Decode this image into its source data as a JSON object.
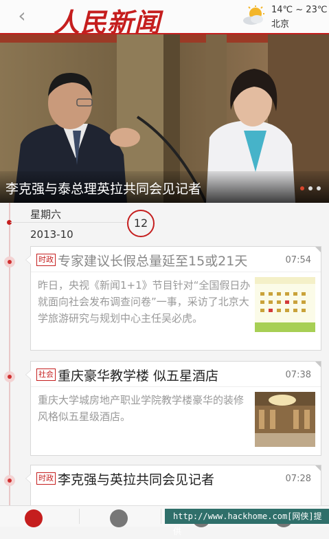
{
  "header": {
    "back_glyph": "‹",
    "logo_text": "人民新闻",
    "weather_icon": "sun-cloud-icon",
    "temperature": "14℃ ~ 23℃",
    "city": "北京"
  },
  "hero": {
    "caption": "李克强与泰总理英拉共同会见记者",
    "dots": 3,
    "active_dot": 0
  },
  "date": {
    "weekday": "星期六",
    "year_month": "2013-10",
    "day": "12"
  },
  "news": [
    {
      "tag": "时政",
      "title": "专家建议长假总量延至15或21天",
      "time": "07:54",
      "summary": "昨日，央视《新闻1+1》节目针对“全国假日办就面向社会发布调查问卷”一事，采访了北京大学旅游研究与规划中心主任吴必虎。"
    },
    {
      "tag": "社会",
      "title": "重庆豪华教学楼 似五星酒店",
      "time": "07:38",
      "summary": "重庆大学城房地产职业学院教学楼豪华的装修风格似五星级酒店。"
    },
    {
      "tag": "时政",
      "title": "李克强与英拉共同会见记者",
      "time": "07:28"
    }
  ],
  "watermark": "http://www.hackhome.com[网侠]提供",
  "colors": {
    "brand_red": "#c51e1e",
    "watermark_bg": "#2f6f6a"
  }
}
